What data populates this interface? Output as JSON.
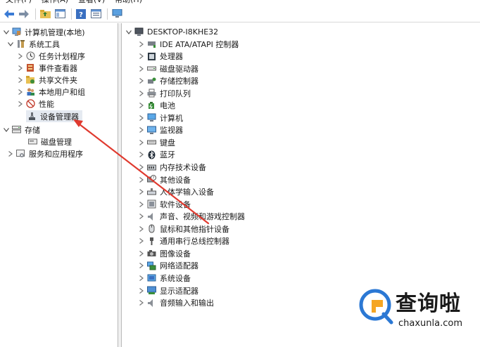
{
  "menubar": [
    "文件(F)",
    "操作(A)",
    "查看(V)",
    "帮助(H)"
  ],
  "toolbar": {
    "buttons": [
      "back-icon",
      "forward-icon",
      "up-folder-icon",
      "show-hide-tree-icon",
      "help-icon",
      "properties-icon",
      "computer-icon"
    ]
  },
  "left_tree": [
    {
      "label": "计算机管理(本地)",
      "icon": "computer-management-icon",
      "level": 0,
      "expand": "chevron-down"
    },
    {
      "label": "系统工具",
      "icon": "tools-icon",
      "level": 1,
      "expand": "chevron-down"
    },
    {
      "label": "任务计划程序",
      "icon": "clock-icon",
      "level": 2,
      "expand": "chevron-right"
    },
    {
      "label": "事件查看器",
      "icon": "event-viewer-icon",
      "level": 2,
      "expand": "chevron-right"
    },
    {
      "label": "共享文件夹",
      "icon": "shared-folder-icon",
      "level": 2,
      "expand": "chevron-right"
    },
    {
      "label": "本地用户和组",
      "icon": "users-icon",
      "level": 2,
      "expand": "chevron-right"
    },
    {
      "label": "性能",
      "icon": "performance-icon",
      "level": 2,
      "expand": "chevron-right"
    },
    {
      "label": "设备管理器",
      "icon": "device-manager-icon",
      "level": 2,
      "expand": "none",
      "selected": true
    },
    {
      "label": "存储",
      "icon": "storage-icon",
      "level": 0,
      "expand": "chevron-down"
    },
    {
      "label": "磁盘管理",
      "icon": "disk-management-icon",
      "level": 1,
      "expand": "none"
    },
    {
      "label": "服务和应用程序",
      "icon": "services-icon",
      "level": 0,
      "expand": "chevron-right"
    }
  ],
  "device_tree": {
    "root": "DESKTOP-I8KHE32",
    "categories": [
      {
        "label": "IDE ATA/ATAPI 控制器",
        "icon": "ide-controller-icon"
      },
      {
        "label": "处理器",
        "icon": "processor-icon"
      },
      {
        "label": "磁盘驱动器",
        "icon": "disk-drive-icon"
      },
      {
        "label": "存储控制器",
        "icon": "storage-controller-icon"
      },
      {
        "label": "打印队列",
        "icon": "printer-icon"
      },
      {
        "label": "电池",
        "icon": "battery-icon"
      },
      {
        "label": "计算机",
        "icon": "computer-icon"
      },
      {
        "label": "监视器",
        "icon": "monitor-icon"
      },
      {
        "label": "键盘",
        "icon": "keyboard-icon"
      },
      {
        "label": "蓝牙",
        "icon": "bluetooth-icon"
      },
      {
        "label": "内存技术设备",
        "icon": "memory-device-icon"
      },
      {
        "label": "其他设备",
        "icon": "other-devices-icon"
      },
      {
        "label": "人体学输入设备",
        "icon": "hid-icon"
      },
      {
        "label": "软件设备",
        "icon": "software-device-icon"
      },
      {
        "label": "声音、视频和游戏控制器",
        "icon": "sound-icon"
      },
      {
        "label": "鼠标和其他指针设备",
        "icon": "mouse-icon"
      },
      {
        "label": "通用串行总线控制器",
        "icon": "usb-icon"
      },
      {
        "label": "图像设备",
        "icon": "camera-icon"
      },
      {
        "label": "网络适配器",
        "icon": "network-adapter-icon"
      },
      {
        "label": "系统设备",
        "icon": "system-device-icon"
      },
      {
        "label": "显示适配器",
        "icon": "display-adapter-icon"
      },
      {
        "label": "音频输入和输出",
        "icon": "audio-io-icon"
      }
    ]
  },
  "watermark": {
    "title": "查询啦",
    "url": "chaxunla.com"
  },
  "colors": {
    "arrow": "#e03a2f",
    "accent": "#2b78d4",
    "selection": "#e5eaf1"
  }
}
